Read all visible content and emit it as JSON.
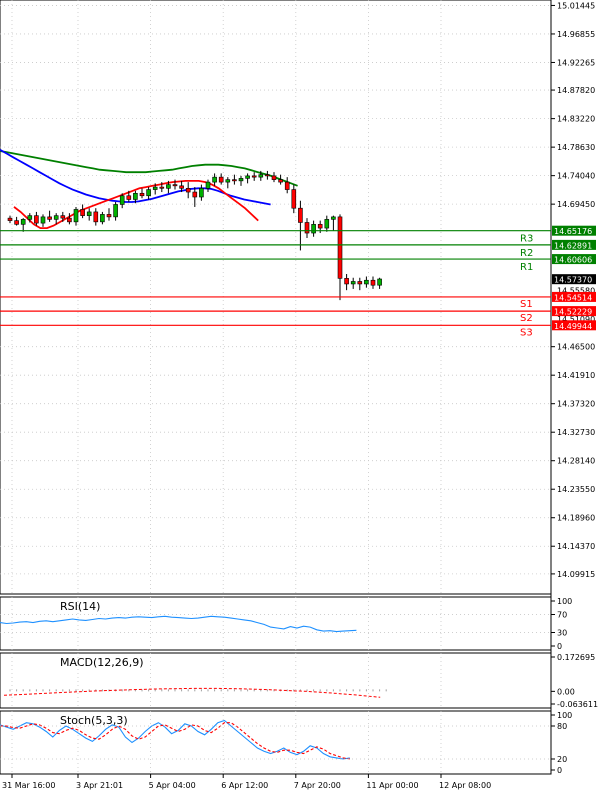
{
  "chart_data": {
    "type": "candlestick",
    "instrument_note": "",
    "price_axis": {
      "range": [
        14.07,
        15.02
      ],
      "ticks": [
        "15.01445",
        "14.96855",
        "14.92265",
        "14.87820",
        "14.83220",
        "14.78630",
        "14.74040",
        "14.69450",
        "14.46500",
        "14.41910",
        "14.37320",
        "14.32730",
        "14.28140",
        "14.23550",
        "14.18960",
        "14.14370",
        "14.09915"
      ],
      "tick_values": [
        15.01445,
        14.96855,
        14.92265,
        14.8782,
        14.8322,
        14.7863,
        14.7404,
        14.6945,
        14.465,
        14.4191,
        14.3732,
        14.3273,
        14.2814,
        14.2355,
        14.1896,
        14.1437,
        14.09915
      ]
    },
    "time_axis": {
      "labels": [
        "31 Mar 16:00",
        "3 Apr 21:01",
        "5 Apr 04:00",
        "6 Apr 12:00",
        "7 Apr 20:00",
        "11 Apr 00:00",
        "12 Apr 08:00"
      ],
      "label_bars": [
        0,
        10,
        21,
        32,
        43,
        54,
        65
      ]
    },
    "levels": [
      {
        "name": "R3",
        "value": 14.65176,
        "label": "14.65176",
        "color": "#008000"
      },
      {
        "name": "R2",
        "value": 14.62891,
        "label": "14.62891",
        "color": "#008000"
      },
      {
        "name": "R1",
        "value": 14.60606,
        "label": "14.60606",
        "color": "#008000"
      },
      {
        "name": "S1",
        "value": 14.54514,
        "label": "14.54514",
        "color": "#ff0000"
      },
      {
        "name": "S2",
        "value": 14.52229,
        "label": "14.52229",
        "color": "#ff0000"
      },
      {
        "name": "S3",
        "value": 14.49944,
        "label": "14.49944",
        "color": "#ff0000"
      }
    ],
    "current_price": {
      "value": 14.5737,
      "label": "14.57370"
    },
    "hidden_tick_partial": [
      {
        "value": 14.5558,
        "label": "14.55580"
      },
      {
        "value": 14.5099,
        "label": "14.51090"
      }
    ],
    "candles": [
      [
        14.672,
        14.676,
        14.664,
        14.668
      ],
      [
        14.668,
        14.674,
        14.66,
        14.662
      ],
      [
        14.662,
        14.672,
        14.65,
        14.67
      ],
      [
        14.67,
        14.68,
        14.665,
        14.676
      ],
      [
        14.676,
        14.682,
        14.66,
        14.664
      ],
      [
        14.664,
        14.678,
        14.658,
        14.674
      ],
      [
        14.674,
        14.684,
        14.666,
        14.67
      ],
      [
        14.67,
        14.68,
        14.662,
        14.676
      ],
      [
        14.676,
        14.682,
        14.666,
        14.672
      ],
      [
        14.672,
        14.68,
        14.662,
        14.666
      ],
      [
        14.666,
        14.69,
        14.66,
        14.686
      ],
      [
        14.686,
        14.694,
        14.672,
        14.676
      ],
      [
        14.676,
        14.688,
        14.668,
        14.682
      ],
      [
        14.682,
        14.688,
        14.66,
        14.666
      ],
      [
        14.666,
        14.682,
        14.662,
        14.678
      ],
      [
        14.678,
        14.688,
        14.668,
        14.674
      ],
      [
        14.674,
        14.698,
        14.668,
        14.694
      ],
      [
        14.694,
        14.712,
        14.688,
        14.708
      ],
      [
        14.708,
        14.716,
        14.698,
        14.702
      ],
      [
        14.702,
        14.716,
        14.696,
        14.712
      ],
      [
        14.712,
        14.72,
        14.704,
        14.708
      ],
      [
        14.708,
        14.722,
        14.702,
        14.718
      ],
      [
        14.718,
        14.728,
        14.71,
        14.722
      ],
      [
        14.722,
        14.73,
        14.714,
        14.72
      ],
      [
        14.72,
        14.732,
        14.712,
        14.726
      ],
      [
        14.726,
        14.734,
        14.718,
        14.724
      ],
      [
        14.724,
        14.732,
        14.714,
        14.72
      ],
      [
        14.72,
        14.73,
        14.704,
        14.714
      ],
      [
        14.714,
        14.722,
        14.69,
        14.706
      ],
      [
        14.706,
        14.726,
        14.7,
        14.72
      ],
      [
        14.72,
        14.734,
        14.714,
        14.73
      ],
      [
        14.73,
        14.744,
        14.724,
        14.738
      ],
      [
        14.738,
        14.744,
        14.726,
        14.73
      ],
      [
        14.73,
        14.738,
        14.72,
        14.734
      ],
      [
        14.734,
        14.742,
        14.726,
        14.732
      ],
      [
        14.732,
        14.74,
        14.724,
        14.736
      ],
      [
        14.736,
        14.744,
        14.728,
        14.74
      ],
      [
        14.74,
        14.746,
        14.732,
        14.738
      ],
      [
        14.738,
        14.748,
        14.732,
        14.742
      ],
      [
        14.742,
        14.748,
        14.734,
        14.74
      ],
      [
        14.74,
        14.746,
        14.73,
        14.734
      ],
      [
        14.734,
        14.742,
        14.726,
        14.73
      ],
      [
        14.73,
        14.738,
        14.712,
        14.718
      ],
      [
        14.718,
        14.726,
        14.68,
        14.688
      ],
      [
        14.688,
        14.7,
        14.62,
        14.665
      ],
      [
        14.665,
        14.672,
        14.64,
        14.648
      ],
      [
        14.648,
        14.668,
        14.642,
        14.662
      ],
      [
        14.662,
        14.668,
        14.648,
        14.656
      ],
      [
        14.656,
        14.676,
        14.65,
        14.67
      ],
      [
        14.67,
        14.676,
        14.652,
        14.674
      ],
      [
        14.674,
        14.678,
        14.54,
        14.575
      ],
      [
        14.575,
        14.582,
        14.556,
        14.566
      ],
      [
        14.566,
        14.576,
        14.558,
        14.57
      ],
      [
        14.57,
        14.576,
        14.556,
        14.566
      ],
      [
        14.566,
        14.578,
        14.56,
        14.572
      ],
      [
        14.572,
        14.578,
        14.558,
        14.564
      ],
      [
        14.564,
        14.576,
        14.558,
        14.574
      ]
    ],
    "ma_lines": [
      {
        "color": "#008000",
        "values": [
          14.782,
          14.78,
          14.778,
          14.776,
          14.774,
          14.772,
          14.77,
          14.768,
          14.766,
          14.764,
          14.762,
          14.76,
          14.758,
          14.756,
          14.754,
          14.752,
          14.75,
          14.749,
          14.748,
          14.747,
          14.746,
          14.746,
          14.746,
          14.746,
          14.747,
          14.748,
          14.749,
          14.75,
          14.752,
          14.754,
          14.756,
          14.757,
          14.758,
          14.758,
          14.758,
          14.757,
          14.756,
          14.754,
          14.752,
          14.749,
          14.746,
          14.743,
          14.74,
          14.736,
          14.732,
          14.728,
          14.724
        ]
      },
      {
        "color": "#0000ff",
        "values": [
          14.782,
          14.776,
          14.77,
          14.764,
          14.758,
          14.752,
          14.746,
          14.74,
          14.734,
          14.728,
          14.723,
          14.718,
          14.714,
          14.71,
          14.707,
          14.704,
          14.702,
          14.7,
          14.699,
          14.698,
          14.698,
          14.699,
          14.701,
          14.703,
          14.706,
          14.709,
          14.712,
          14.715,
          14.717,
          14.719,
          14.72,
          14.72,
          14.719,
          14.716,
          14.712,
          14.708,
          14.705,
          14.702,
          14.7,
          14.698,
          14.696,
          14.694
        ]
      },
      {
        "color": "#ff0000",
        "values": [
          14.69,
          14.682,
          14.672,
          14.662,
          14.656,
          14.656,
          14.66,
          14.666,
          14.672,
          14.678,
          14.684,
          14.688,
          14.692,
          14.696,
          14.7,
          14.704,
          14.708,
          14.712,
          14.716,
          14.72,
          14.722,
          14.724,
          14.726,
          14.728,
          14.73,
          14.731,
          14.732,
          14.732,
          14.732,
          14.73,
          14.726,
          14.72,
          14.712,
          14.704,
          14.696,
          14.688,
          14.678,
          14.668
        ]
      }
    ],
    "rsi": {
      "label": "RSI(14)",
      "scale": {
        "max": 100,
        "min": 0,
        "ticks": [
          "100",
          "70",
          "30",
          "0"
        ],
        "tick_values": [
          100,
          70,
          30,
          0
        ]
      },
      "values": [
        52,
        50,
        51,
        53,
        54,
        52,
        55,
        56,
        54,
        56,
        58,
        60,
        58,
        57,
        59,
        61,
        60,
        62,
        63,
        62,
        64,
        65,
        64,
        63,
        65,
        66,
        64,
        63,
        62,
        61,
        62,
        64,
        66,
        65,
        64,
        62,
        60,
        58,
        56,
        52,
        48,
        42,
        40,
        38,
        43,
        40,
        44,
        42,
        36,
        33,
        34,
        32,
        33,
        34,
        35
      ]
    },
    "macd": {
      "label": "MACD(12,26,9)",
      "scale": {
        "max": 0.172695,
        "min": -0.063611,
        "ticks": [
          "0.172695",
          "0.00",
          "-0.063611"
        ],
        "tick_values": [
          0.172695,
          0,
          -0.063611
        ]
      },
      "signal_values": [
        -0.02,
        -0.017,
        -0.014,
        -0.011,
        -0.008,
        -0.005,
        -0.002,
        0.001,
        0.004,
        0.006,
        0.008,
        0.01,
        0.012,
        0.013,
        0.014,
        0.015,
        0.015,
        0.015,
        0.014,
        0.013,
        0.011,
        0.009,
        0.006,
        0.003,
        0.0,
        -0.004,
        -0.008,
        -0.013,
        -0.018,
        -0.024,
        -0.03
      ]
    },
    "stoch": {
      "label": "Stoch(5,3,3)",
      "scale": {
        "max": 100,
        "min": 0,
        "ticks": [
          "100",
          "80",
          "20",
          "0"
        ],
        "tick_values": [
          100,
          80,
          20,
          0
        ]
      },
      "main": [
        82,
        78,
        74,
        80,
        86,
        84,
        78,
        70,
        60,
        72,
        80,
        74,
        66,
        58,
        52,
        62,
        74,
        82,
        78,
        60,
        50,
        58,
        70,
        80,
        86,
        78,
        66,
        72,
        84,
        80,
        70,
        64,
        74,
        86,
        90,
        80,
        70,
        60,
        50,
        40,
        34,
        30,
        34,
        40,
        32,
        28,
        34,
        44,
        40,
        30,
        24,
        22,
        20,
        22
      ],
      "signal": [
        80,
        80,
        77,
        76,
        80,
        84,
        82,
        76,
        68,
        66,
        72,
        76,
        72,
        64,
        58,
        56,
        64,
        74,
        80,
        74,
        62,
        56,
        60,
        70,
        80,
        82,
        76,
        70,
        74,
        82,
        80,
        72,
        68,
        76,
        86,
        86,
        78,
        68,
        58,
        48,
        40,
        34,
        32,
        36,
        36,
        32,
        30,
        36,
        42,
        38,
        30,
        26,
        22,
        20
      ]
    }
  }
}
